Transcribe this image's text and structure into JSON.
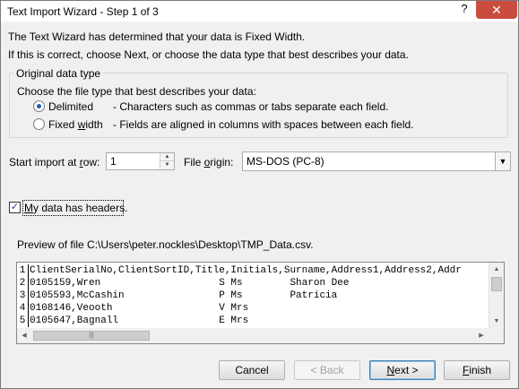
{
  "window": {
    "title": "Text Import Wizard - Step 1 of 3",
    "help_glyph": "?",
    "close_glyph": "✕"
  },
  "intro": {
    "line1": "The Text Wizard has determined that your data is Fixed Width.",
    "line2": "If this is correct, choose Next, or choose the data type that best describes your data."
  },
  "data_type": {
    "legend": "Original data type",
    "prompt": "Choose the file type that best describes your data:",
    "delimited": {
      "label": "Delimited",
      "description": "- Characters such as commas or tabs separate each field.",
      "selected": true
    },
    "fixed": {
      "label_prefix": "Fixed ",
      "label_access": "w",
      "label_suffix": "idth",
      "description": "- Fields are aligned in columns with spaces between each field.",
      "selected": false
    }
  },
  "start_row": {
    "label_prefix": "Start import at ",
    "label_access": "r",
    "label_suffix": "ow:",
    "value": "1",
    "up_glyph": "▲",
    "down_glyph": "▼"
  },
  "file_origin": {
    "label_prefix": "File ",
    "label_access": "o",
    "label_suffix": "rigin:",
    "value": "MS-DOS (PC-8)",
    "arrow_glyph": "▼"
  },
  "headers_option": {
    "label_access": "M",
    "label_suffix": "y data has headers.",
    "checked": true,
    "check_glyph": "✓"
  },
  "preview": {
    "label": "Preview of file C:\\Users\\peter.nockles\\Desktop\\TMP_Data.csv.",
    "lines": [
      {
        "num": "1",
        "text": "ClientSerialNo,ClientSortID,Title,Initials,Surname,Address1,Address2,Addr"
      },
      {
        "num": "2",
        "text": "0105159,Wren                    S Ms        Sharon Dee"
      },
      {
        "num": "3",
        "text": "0105593,McCashin                P Ms        Patricia"
      },
      {
        "num": "4",
        "text": "0108146,Veooth                  V Mrs"
      },
      {
        "num": "5",
        "text": "0105647,Bagnall                 E Mrs"
      }
    ],
    "scroll_up": "▲",
    "scroll_down": "▼",
    "scroll_left": "◀",
    "scroll_right": "▶",
    "thumb_grip": "|||"
  },
  "buttons": {
    "cancel": "Cancel",
    "back": "< Back",
    "next_access": "N",
    "next_suffix": "ext >",
    "finish_access": "F",
    "finish_suffix": "inish"
  }
}
